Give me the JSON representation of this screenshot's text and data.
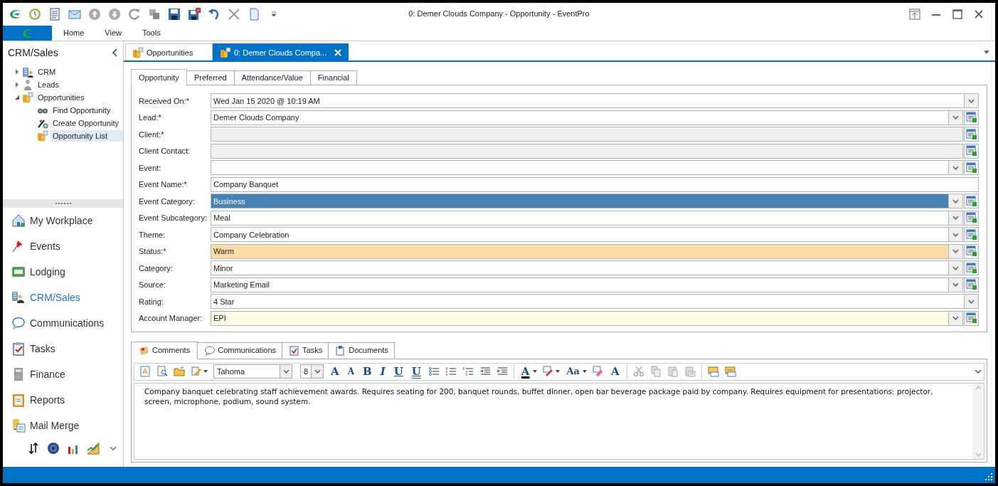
{
  "window": {
    "title": "0: Demer Clouds Company - Opportunity - EventPro"
  },
  "ribbon_tabs": [
    {
      "label": "Home"
    },
    {
      "label": "View"
    },
    {
      "label": "Tools"
    }
  ],
  "sidebar": {
    "title": "CRM/Sales",
    "tree": [
      {
        "label": "CRM",
        "expanded": false,
        "selected": false
      },
      {
        "label": "Leads",
        "expanded": false,
        "selected": false
      },
      {
        "label": "Opportunities",
        "expanded": true,
        "selected": false,
        "children": [
          {
            "label": "Find Opportunity",
            "selected": false
          },
          {
            "label": "Create Opportunity",
            "selected": false
          },
          {
            "label": "Opportunity List",
            "selected": true
          }
        ]
      }
    ],
    "nav": [
      {
        "label": "My Workplace",
        "selected": false
      },
      {
        "label": "Events",
        "selected": false
      },
      {
        "label": "Lodging",
        "selected": false
      },
      {
        "label": "CRM/Sales",
        "selected": true
      },
      {
        "label": "Communications",
        "selected": false
      },
      {
        "label": "Tasks",
        "selected": false
      },
      {
        "label": "Finance",
        "selected": false
      },
      {
        "label": "Reports",
        "selected": false
      },
      {
        "label": "Mail Merge",
        "selected": false
      }
    ]
  },
  "document_tabs": [
    {
      "label": "Opportunities",
      "selected": false
    },
    {
      "label": "0: Demer Clouds Compa...",
      "selected": true
    }
  ],
  "form": {
    "tabs": [
      {
        "label": "Opportunity",
        "selected": true
      },
      {
        "label": "Preferred",
        "selected": false
      },
      {
        "label": "Attendance/Value",
        "selected": false
      },
      {
        "label": "Financial",
        "selected": false
      }
    ],
    "fields": [
      {
        "label": "Received On:*",
        "value": "Wed Jan 15 2020 @ 10:19 AM",
        "dropdown": true,
        "lookup": false,
        "disabled": false,
        "selected": false
      },
      {
        "label": "Lead:*",
        "value": "Demer Clouds Company",
        "dropdown": true,
        "lookup": true,
        "disabled": false,
        "selected": false
      },
      {
        "label": "Client:*",
        "dropdown": false,
        "lookup": true,
        "disabled": true,
        "selected": false
      },
      {
        "label": "Client Contact:",
        "dropdown": false,
        "lookup": true,
        "disabled": true,
        "selected": false
      },
      {
        "label": "Event:",
        "dropdown": true,
        "lookup": true,
        "disabled": false,
        "selected": false
      },
      {
        "label": "Event Name:*",
        "value": "Company Banquet",
        "dropdown": false,
        "lookup": false,
        "disabled": false,
        "selected": false
      },
      {
        "label": "Event Category:",
        "value": "Business",
        "dropdown": true,
        "lookup": true,
        "disabled": false,
        "selected": true
      },
      {
        "label": "Event Subcategory:",
        "value": "Meal",
        "dropdown": true,
        "lookup": true,
        "disabled": false,
        "selected": false
      },
      {
        "label": "Theme:",
        "value": "Company Celebration",
        "dropdown": true,
        "lookup": true,
        "disabled": false,
        "selected": false
      },
      {
        "label": "Status:*",
        "value": "Warm",
        "dropdown": true,
        "lookup": true,
        "disabled": false,
        "selected": false,
        "color": "#fddcaa"
      },
      {
        "label": "Category:",
        "value": "Minor",
        "dropdown": true,
        "lookup": true,
        "disabled": false,
        "selected": false
      },
      {
        "label": "Source:",
        "value": "Marketing Email",
        "dropdown": true,
        "lookup": true,
        "disabled": false,
        "selected": false
      },
      {
        "label": "Rating:",
        "value": "4 Star",
        "dropdown": true,
        "lookup": false,
        "disabled": false,
        "selected": false
      },
      {
        "label": "Account Manager:",
        "value": "EPI",
        "dropdown": true,
        "lookup": true,
        "disabled": false,
        "selected": false,
        "color": "#fffbe6"
      }
    ]
  },
  "detail": {
    "tabs": [
      {
        "label": "Comments",
        "selected": true
      },
      {
        "label": "Communications",
        "selected": false
      },
      {
        "label": "Tasks",
        "selected": false
      },
      {
        "label": "Documents",
        "selected": false
      }
    ],
    "toolbar": [
      {
        "kind": "document"
      },
      {
        "kind": "find"
      },
      {
        "kind": "open"
      },
      {
        "kind": "edit"
      },
      {
        "kind": "font",
        "value": "Tahoma"
      },
      {
        "kind": "size",
        "value": "8"
      },
      {
        "kind": "grow",
        "text": "A"
      },
      {
        "kind": "shrink",
        "text": "A"
      },
      {
        "kind": "bold",
        "text": "B"
      },
      {
        "kind": "italic",
        "text": "I"
      },
      {
        "kind": "underline",
        "text": "U"
      },
      {
        "kind": "double-underline",
        "text": "U"
      },
      {
        "kind": "bullets"
      },
      {
        "kind": "numbering"
      },
      {
        "kind": "multilevel"
      },
      {
        "kind": "outdent"
      },
      {
        "kind": "indent"
      },
      {
        "kind": "separator"
      },
      {
        "kind": "font-color",
        "text": "A"
      },
      {
        "kind": "highlight"
      },
      {
        "kind": "change-case",
        "text": "Aa"
      },
      {
        "kind": "clear-format"
      },
      {
        "kind": "font-dialog",
        "text": "A"
      },
      {
        "kind": "separator"
      },
      {
        "kind": "cut"
      },
      {
        "kind": "copy"
      },
      {
        "kind": "paste"
      },
      {
        "kind": "paste-special"
      },
      {
        "kind": "separator"
      },
      {
        "kind": "insert-field"
      },
      {
        "kind": "insert-text"
      }
    ],
    "text": "Company banquet celebrating staff achievement awards. Requires seating for 200, banquet rounds, buffet dinner, open bar beverage package paid by company. Requires equipment for presentations: projector, screen, microphone, podium, sound system."
  }
}
